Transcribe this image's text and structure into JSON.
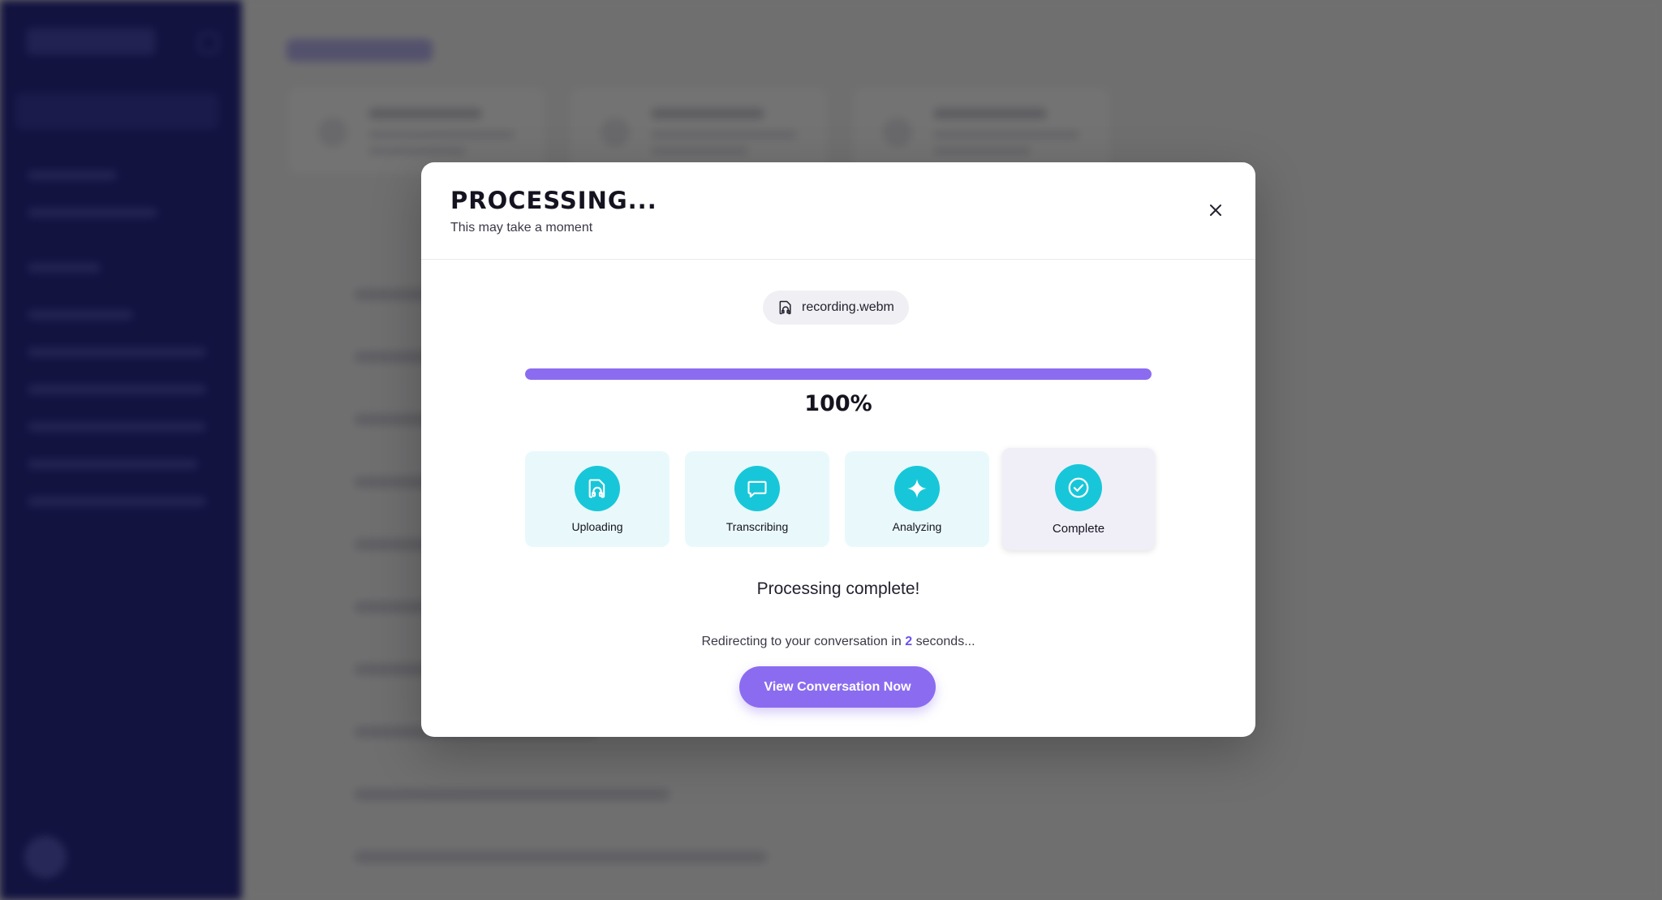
{
  "modal": {
    "title": "PROCESSING...",
    "subtitle": "This may take a moment",
    "close_icon": "close-icon",
    "file": {
      "icon": "audio-file-icon",
      "name": "recording.webm"
    },
    "progress": {
      "value": 100,
      "label": "100%"
    },
    "steps": [
      {
        "label": "Uploading",
        "icon": "audio-file-icon",
        "state": "done"
      },
      {
        "label": "Transcribing",
        "icon": "chat-bubble-icon",
        "state": "done"
      },
      {
        "label": "Analyzing",
        "icon": "sparkle-icon",
        "state": "done"
      },
      {
        "label": "Complete",
        "icon": "check-circle-icon",
        "state": "active"
      }
    ],
    "status": "Processing complete!",
    "redirect": {
      "prefix": "Redirecting to your conversation in",
      "count": "2",
      "suffix": "seconds..."
    },
    "cta_label": "View Conversation Now"
  },
  "colors": {
    "accent": "#8b6cf0",
    "step_icon": "#17c7d9",
    "step_bg": "#e9f9fb",
    "sidebar": "#2a2a8f",
    "overlay": "rgba(0,0,0,0.55)"
  }
}
